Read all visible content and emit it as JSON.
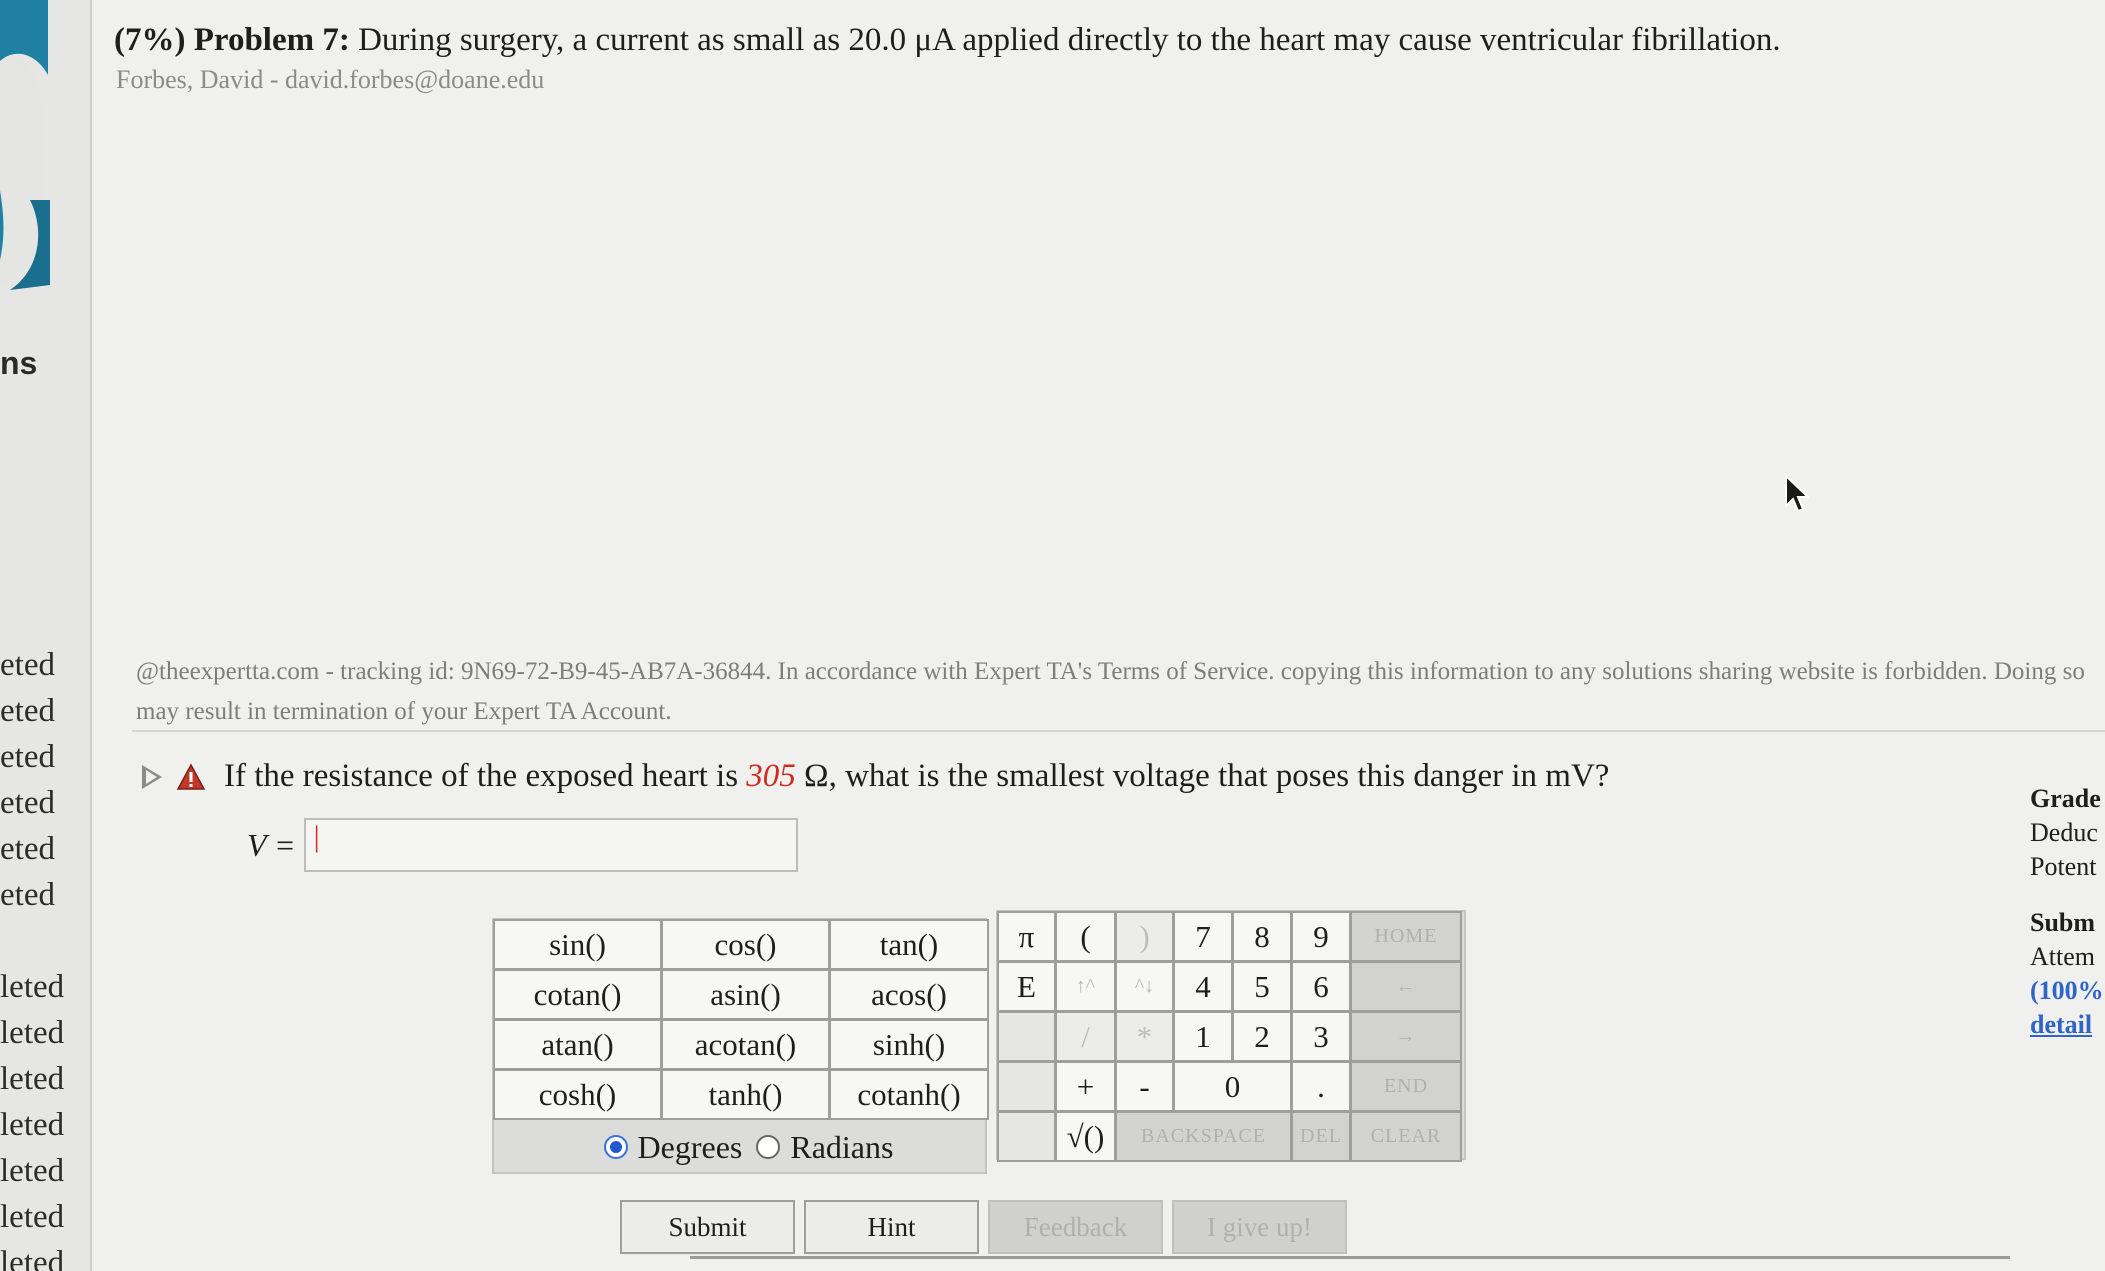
{
  "sidebar": {
    "partial_label": "ns",
    "items": [
      "eted",
      "eted",
      "eted",
      "eted",
      "eted",
      "eted",
      "leted",
      "leted",
      "leted",
      "leted",
      "leted",
      "leted",
      "leted"
    ]
  },
  "problem": {
    "percent": "(7%)",
    "number": "Problem 7:",
    "statement": "During surgery, a current as small as 20.0 μA applied directly to the heart may cause ventricular fibrillation.",
    "author": "Forbes, David - david.forbes@doane.edu"
  },
  "tracking": {
    "text": "@theexpertta.com - tracking id: 9N69-72-B9-45-AB7A-36844. In accordance with Expert TA's Terms of Service. copying this information to any solutions sharing website is forbidden. Doing so may result in termination of your Expert TA Account."
  },
  "question": {
    "prefix": "If the resistance of the exposed heart is",
    "value": "305",
    "suffix": "Ω, what is the smallest voltage that poses this danger in mV?"
  },
  "answer": {
    "label": "V =",
    "value": "|"
  },
  "function_keys": [
    "sin()",
    "cos()",
    "tan()",
    "cotan()",
    "asin()",
    "acos()",
    "atan()",
    "acotan()",
    "sinh()",
    "cosh()",
    "tanh()",
    "cotanh()"
  ],
  "angle_mode": {
    "degrees": "Degrees",
    "radians": "Radians",
    "selected": "Degrees"
  },
  "numpad": {
    "pi": "π",
    "paren_open": "(",
    "paren_close": ")",
    "k7": "7",
    "k8": "8",
    "k9": "9",
    "home": "HOME",
    "e": "E",
    "up": "↑^",
    "down": "^↓",
    "k4": "4",
    "k5": "5",
    "k6": "6",
    "left": "←",
    "divide": "/",
    "multiply": "*",
    "k1": "1",
    "k2": "2",
    "k3": "3",
    "right": "→",
    "plus": "+",
    "minus": "-",
    "k0": "0",
    "dot": ".",
    "end": "END",
    "sqrt": "√()",
    "backspace": "BACKSPACE",
    "del": "DEL",
    "clear": "CLEAR"
  },
  "actions": {
    "submit": "Submit",
    "hint": "Hint",
    "feedback": "Feedback",
    "give_up": "I give up!"
  },
  "right_panel": {
    "grade": "Grade",
    "deduc": "Deduc",
    "potent": "Potent",
    "subm": "Subm",
    "attem": "Attem",
    "pct": "(100%",
    "details": "detail"
  },
  "colors": {
    "highlight": "#d02a1f",
    "radio_selected": "#2058d4",
    "logo_teal": "#1e7fa0"
  }
}
